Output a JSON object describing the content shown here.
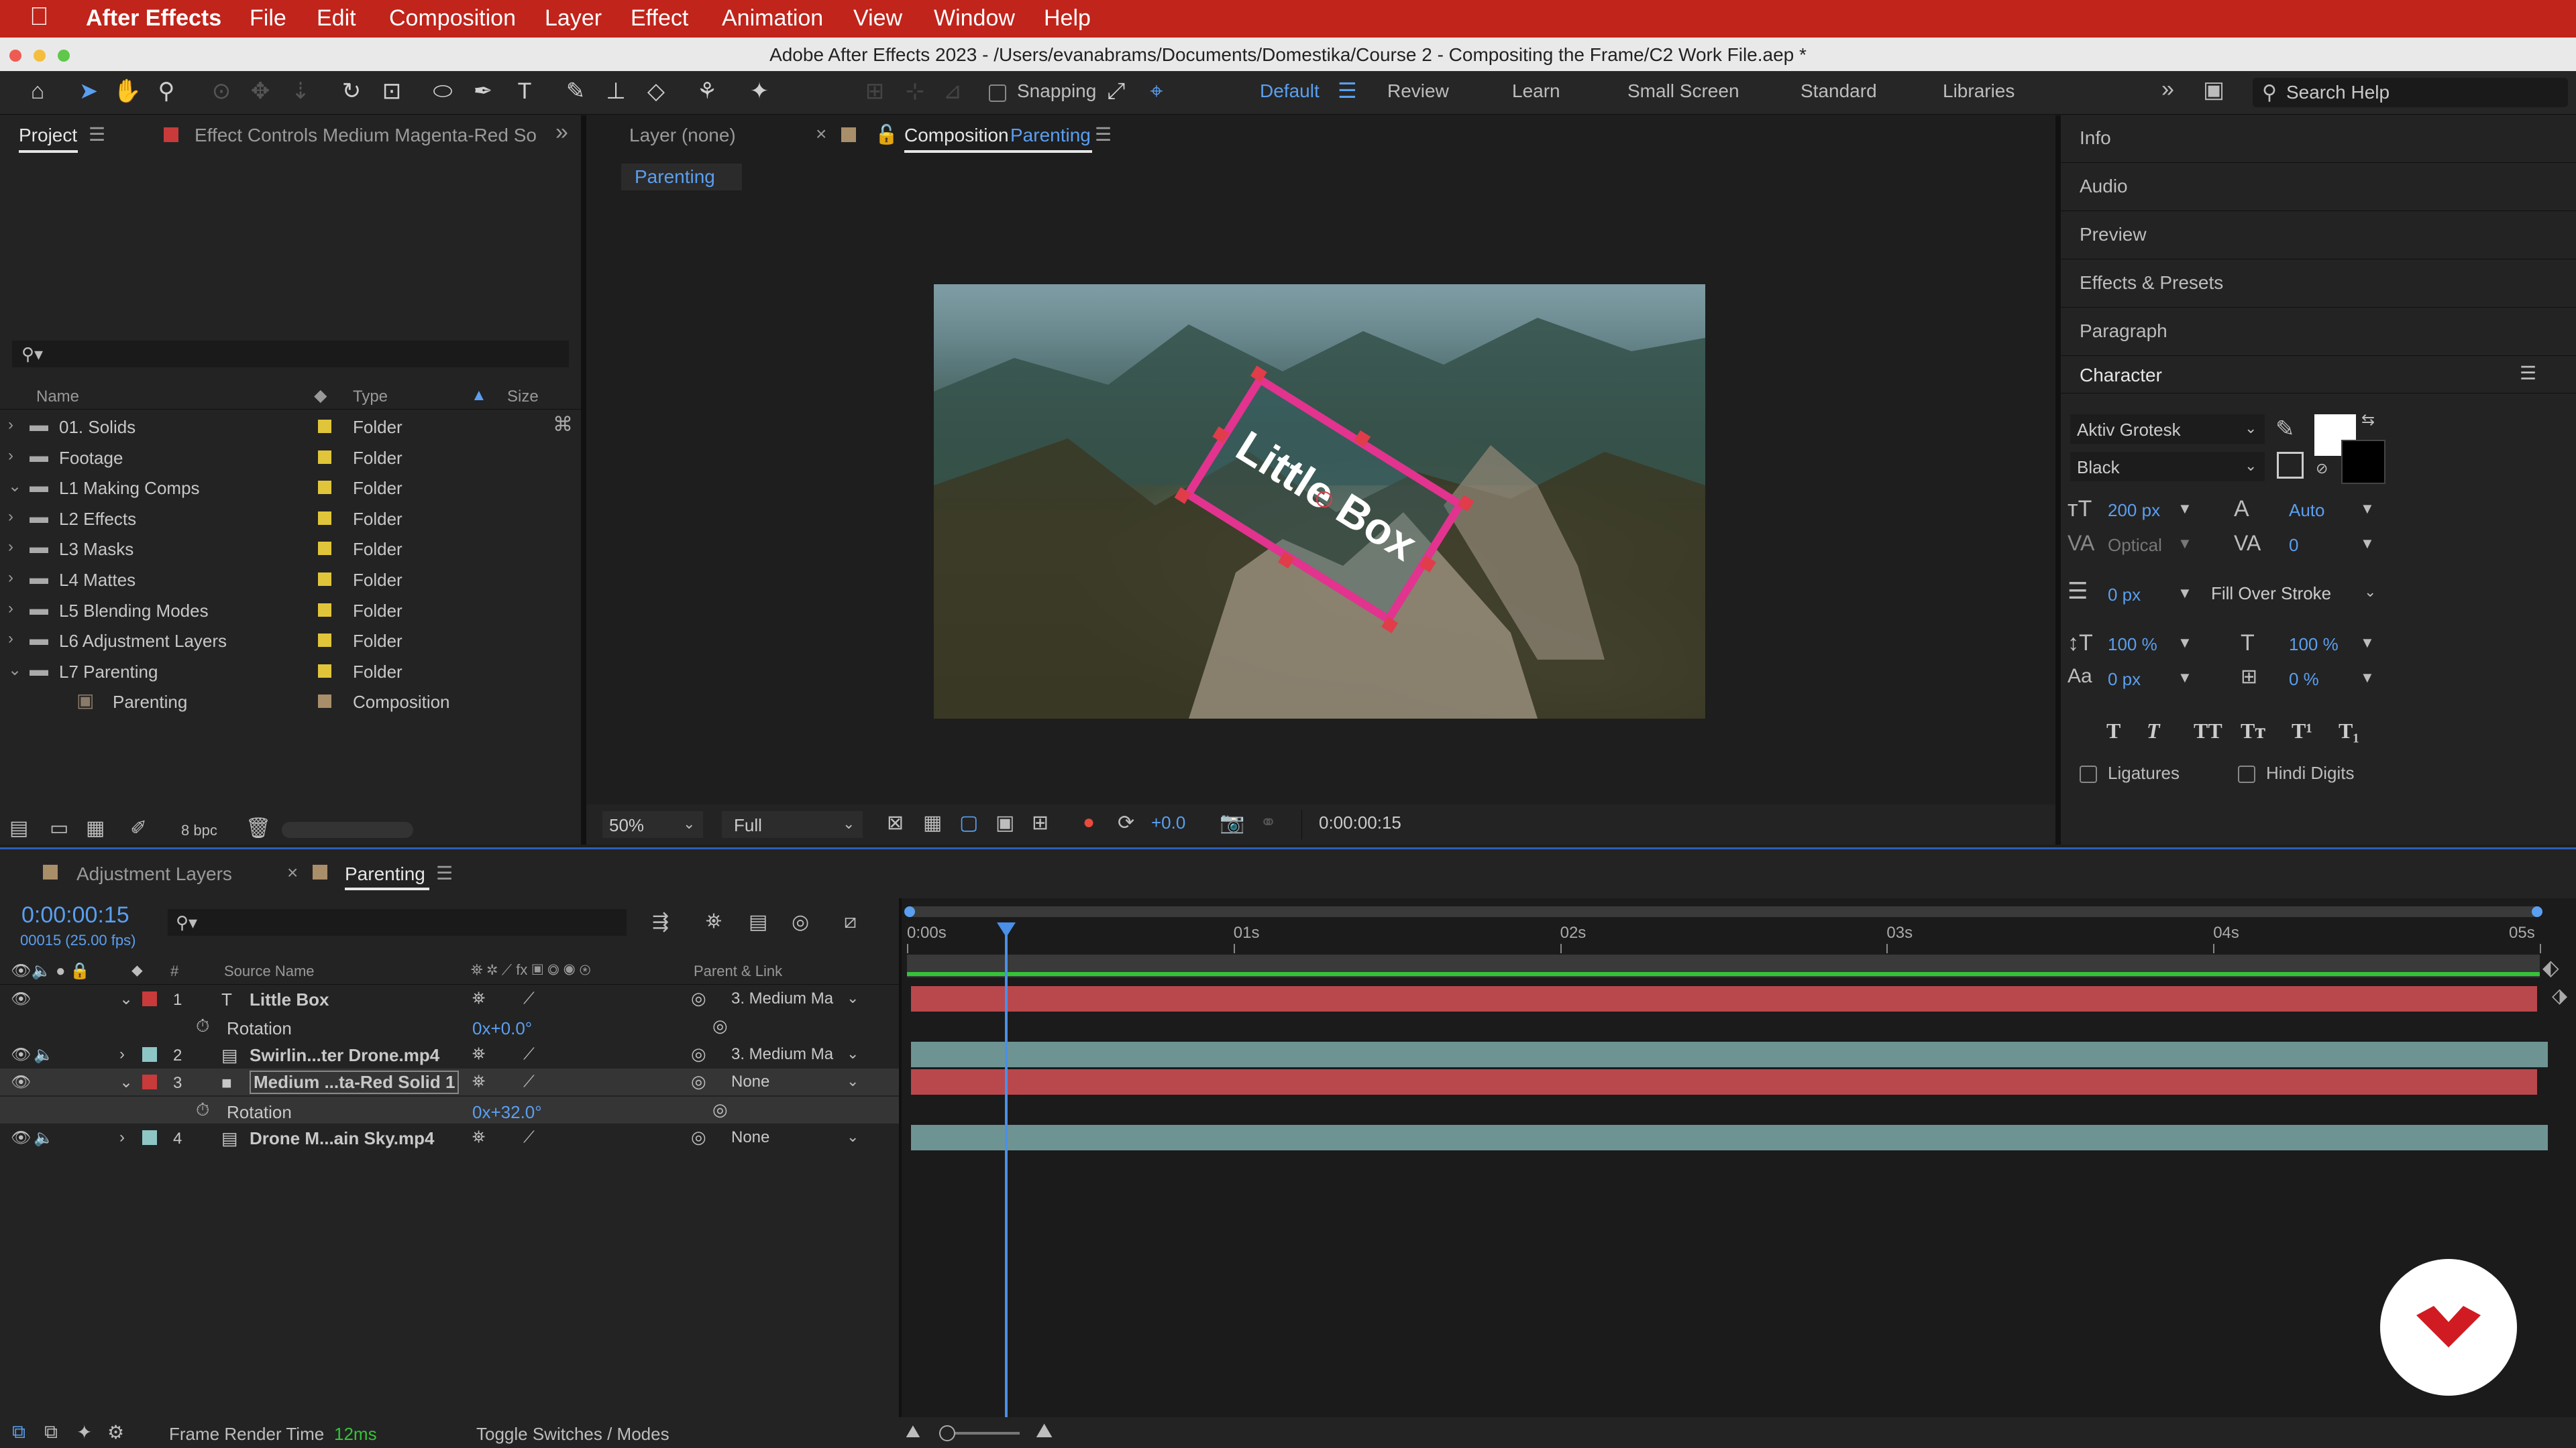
{
  "menubar": {
    "app_name": "After Effects",
    "items": [
      "File",
      "Edit",
      "Composition",
      "Layer",
      "Effect",
      "Animation",
      "View",
      "Window",
      "Help"
    ]
  },
  "titlebar": {
    "title": "Adobe After Effects 2023 - /Users/evanabrams/Documents/Domestika/Course 2 - Compositing the Frame/C2 Work File.aep *"
  },
  "toolbar": {
    "snapping_label": "Snapping",
    "workspaces": [
      "Default",
      "Review",
      "Learn",
      "Small Screen",
      "Standard",
      "Libraries"
    ],
    "active_workspace": "Default",
    "search_placeholder": "Search Help"
  },
  "project": {
    "tab_label": "Project",
    "effect_controls_tab": "Effect Controls Medium Magenta-Red So",
    "search_value": "",
    "columns": {
      "name": "Name",
      "type": "Type",
      "size": "Size"
    },
    "items": [
      {
        "name": "01. Solids",
        "type": "Folder",
        "expanded": false,
        "color": "#e0c53a"
      },
      {
        "name": "Footage",
        "type": "Folder",
        "expanded": false,
        "color": "#e0c53a"
      },
      {
        "name": "L1 Making Comps",
        "type": "Folder",
        "expanded": true,
        "color": "#e0c53a"
      },
      {
        "name": "L2 Effects",
        "type": "Folder",
        "expanded": false,
        "color": "#e0c53a"
      },
      {
        "name": "L3 Masks",
        "type": "Folder",
        "expanded": false,
        "color": "#e0c53a"
      },
      {
        "name": "L4 Mattes",
        "type": "Folder",
        "expanded": false,
        "color": "#e0c53a"
      },
      {
        "name": "L5 Blending Modes",
        "type": "Folder",
        "expanded": false,
        "color": "#e0c53a"
      },
      {
        "name": "L6 Adjustment Layers",
        "type": "Folder",
        "expanded": false,
        "color": "#e0c53a"
      },
      {
        "name": "L7 Parenting",
        "type": "Folder",
        "expanded": true,
        "color": "#e0c53a"
      },
      {
        "name": "Parenting",
        "type": "Composition",
        "expanded": false,
        "color": "#a98e6a",
        "child": true
      }
    ],
    "bpc_label": "8 bpc"
  },
  "viewer": {
    "layer_tab": "Layer (none)",
    "comp_tab_prefix": "Composition",
    "comp_tab_name": "Parenting",
    "subtab": "Parenting",
    "box_text": "Little Box",
    "zoom": "50%",
    "resolution": "Full",
    "exposure": "+0.0",
    "timecode": "0:00:00:15"
  },
  "right_panels": [
    "Info",
    "Audio",
    "Preview",
    "Effects & Presets",
    "Paragraph"
  ],
  "character": {
    "title": "Character",
    "font": "Aktiv Grotesk",
    "style": "Black",
    "size": "200 px",
    "leading": "Auto",
    "kerning": "Optical",
    "tracking": "0",
    "stroke_width": "0 px",
    "stroke_mode": "Fill Over Stroke",
    "vscale": "100 %",
    "hscale": "100 %",
    "baseline": "0 px",
    "tsume": "0 %",
    "ligatures_label": "Ligatures",
    "hindi_label": "Hindi Digits",
    "style_buttons": [
      "T",
      "T",
      "TT",
      "Tт",
      "T¹",
      "T₁"
    ]
  },
  "timeline": {
    "tabs": [
      "Adjustment Layers",
      "Parenting"
    ],
    "active_tab": "Parenting",
    "timecode": "0:00:00:15",
    "frame_info": "00015 (25.00 fps)",
    "col_source": "Source Name",
    "col_parent": "Parent & Link",
    "col_num": "#",
    "ruler": [
      "0:00s",
      "01s",
      "02s",
      "03s",
      "04s",
      "05s"
    ],
    "playhead_fraction": 0.06,
    "layers": [
      {
        "num": "1",
        "name": "Little Box",
        "color": "#c93a3a",
        "icon": "T",
        "parent": "3. Medium Ma",
        "bar": "#b9484c",
        "expanded": true
      },
      {
        "prop": "Rotation",
        "value": "0x+0.0°"
      },
      {
        "num": "2",
        "name": "Swirlin...ter Drone.mp4",
        "color": "#8ec6c6",
        "icon": "▤",
        "parent": "3. Medium Ma",
        "bar": "#6e9393",
        "expanded": false
      },
      {
        "num": "3",
        "name": "Medium ...ta-Red Solid 1",
        "color": "#c93a3a",
        "icon": "■",
        "parent": "None",
        "bar": "#b9484c",
        "expanded": true,
        "selected": true
      },
      {
        "prop": "Rotation",
        "value": "0x+32.0°",
        "selected": true
      },
      {
        "num": "4",
        "name": "Drone M...ain Sky.mp4",
        "color": "#8ec6c6",
        "icon": "▤",
        "parent": "None",
        "bar": "#6e9393",
        "expanded": false
      }
    ],
    "status_label": "Frame Render Time",
    "status_value": "12ms",
    "toggle_label": "Toggle Switches / Modes"
  }
}
